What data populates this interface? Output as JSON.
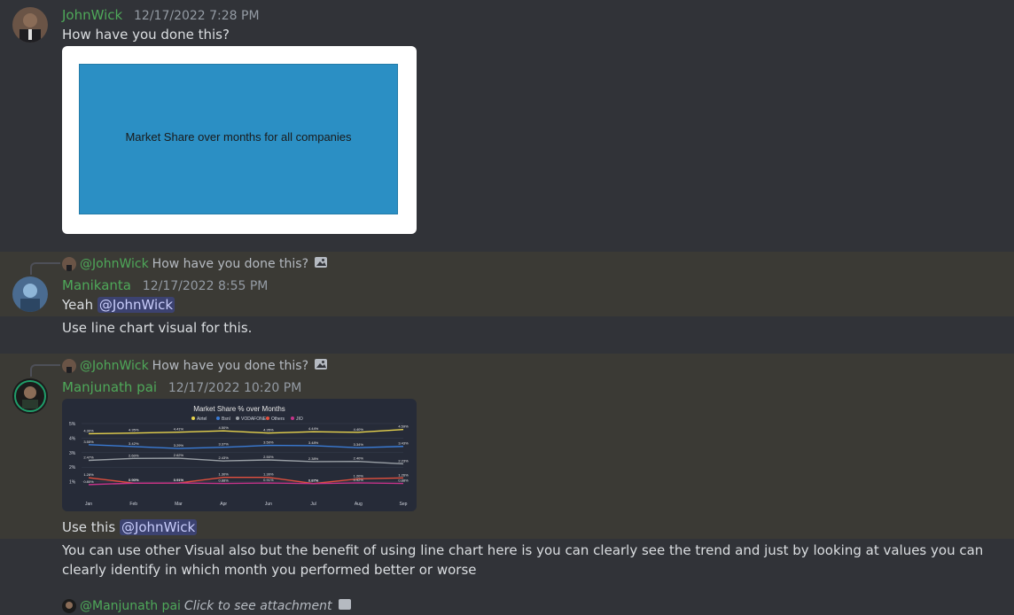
{
  "messages": [
    {
      "author": "JohnWick",
      "timestamp": "12/17/2022 7:28 PM",
      "text": "How have you done this?",
      "image_text": "Market Share over months for all companies"
    },
    {
      "reply_mention": "@JohnWick",
      "reply_text": "How have you done this?",
      "author": "Manikanta",
      "timestamp": "12/17/2022 8:55 PM",
      "text_prefix": "Yeah",
      "mention": "@JohnWick",
      "followup": "Use line chart visual for this."
    },
    {
      "reply_mention": "@JohnWick",
      "reply_text": "How have you done this?",
      "author": "Manjunath pai",
      "timestamp": "12/17/2022 10:20 PM",
      "chart_title": "Market Share % over Months",
      "legend": [
        "Airtel",
        "Bsnl",
        "VODAFONE",
        "Others",
        "JIO"
      ],
      "months": [
        "Jan",
        "Feb",
        "Mar",
        "Apr",
        "Jun",
        "Jul",
        "Aug",
        "Sep"
      ],
      "text_prefix": "Use this",
      "mention": "@JohnWick",
      "followup": "You can use other Visual also but the benefit of using line chart here is you can clearly see the trend and just by looking at values you can clearly identify in which month you performed better or worse"
    },
    {
      "reply_mention": "@Manjunath pai",
      "reply_text": "Click to see attachment"
    }
  ],
  "chart_data": {
    "type": "line",
    "title": "Market Share % over Months",
    "categories": [
      "Jan",
      "Feb",
      "Mar",
      "Apr",
      "Jun",
      "Jul",
      "Aug",
      "Sep"
    ],
    "series": [
      {
        "name": "Airtel",
        "color": "#e8d44d",
        "values": [
          4.3,
          4.35,
          4.41,
          4.5,
          4.35,
          4.44,
          4.4,
          4.59
        ]
      },
      {
        "name": "Bsnl",
        "color": "#3a7bd5",
        "values": [
          3.55,
          3.42,
          3.29,
          3.37,
          3.5,
          3.48,
          3.34,
          3.43
        ]
      },
      {
        "name": "VODAFONE",
        "color": "#9aa0a6",
        "values": [
          2.47,
          2.6,
          2.62,
          2.43,
          2.5,
          2.38,
          2.4,
          2.23
        ]
      },
      {
        "name": "Others",
        "color": "#e3503e",
        "values": [
          1.28,
          0.9,
          0.91,
          1.3,
          1.3,
          0.87,
          1.2,
          1.26
        ]
      },
      {
        "name": "JIO",
        "color": "#c4338a",
        "values": [
          0.8,
          0.9,
          0.91,
          0.88,
          0.91,
          0.87,
          0.92,
          0.88
        ]
      }
    ],
    "ylim": [
      0,
      5
    ]
  },
  "colors": {
    "username": "#4ea859",
    "mention_bg": "#3c4270",
    "highlight": "#3b3a35"
  }
}
